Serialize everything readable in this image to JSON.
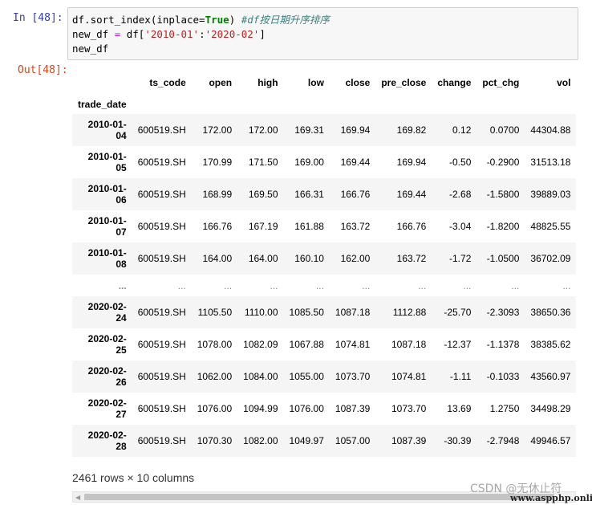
{
  "input_prompt": "In  [48]:",
  "output_prompt": "Out[48]:",
  "code": {
    "line1": {
      "a": "df.sort_index(inplace=",
      "kw": "True",
      "b": ") ",
      "comment": "#df按日期升序排序"
    },
    "line2": {
      "a": "new_df ",
      "op": "=",
      "b": " df[",
      "s1": "'2010-01'",
      "c": ":",
      "s2": "'2020-02'",
      "d": "]"
    },
    "line3": "new_df"
  },
  "table": {
    "columns": [
      "ts_code",
      "open",
      "high",
      "low",
      "close",
      "pre_close",
      "change",
      "pct_chg",
      "vol"
    ],
    "index_name": "trade_date",
    "rows": [
      {
        "index": "2010-01-04",
        "cells": [
          "600519.SH",
          "172.00",
          "172.00",
          "169.31",
          "169.94",
          "169.82",
          "0.12",
          "0.0700",
          "44304.88"
        ]
      },
      {
        "index": "2010-01-05",
        "cells": [
          "600519.SH",
          "170.99",
          "171.50",
          "169.00",
          "169.44",
          "169.94",
          "-0.50",
          "-0.2900",
          "31513.18"
        ]
      },
      {
        "index": "2010-01-06",
        "cells": [
          "600519.SH",
          "168.99",
          "169.50",
          "166.31",
          "166.76",
          "169.44",
          "-2.68",
          "-1.5800",
          "39889.03"
        ]
      },
      {
        "index": "2010-01-07",
        "cells": [
          "600519.SH",
          "166.76",
          "167.19",
          "161.88",
          "163.72",
          "166.76",
          "-3.04",
          "-1.8200",
          "48825.55"
        ]
      },
      {
        "index": "2010-01-08",
        "cells": [
          "600519.SH",
          "164.00",
          "164.00",
          "160.10",
          "162.00",
          "163.72",
          "-1.72",
          "-1.0500",
          "36702.09"
        ]
      },
      {
        "index": "...",
        "cells": [
          "...",
          "...",
          "...",
          "...",
          "...",
          "...",
          "...",
          "...",
          "..."
        ]
      },
      {
        "index": "2020-02-24",
        "cells": [
          "600519.SH",
          "1105.50",
          "1110.00",
          "1085.50",
          "1087.18",
          "1112.88",
          "-25.70",
          "-2.3093",
          "38650.36"
        ]
      },
      {
        "index": "2020-02-25",
        "cells": [
          "600519.SH",
          "1078.00",
          "1082.09",
          "1067.88",
          "1074.81",
          "1087.18",
          "-12.37",
          "-1.1378",
          "38385.62"
        ]
      },
      {
        "index": "2020-02-26",
        "cells": [
          "600519.SH",
          "1062.00",
          "1084.00",
          "1055.00",
          "1073.70",
          "1074.81",
          "-1.11",
          "-0.1033",
          "43560.97"
        ]
      },
      {
        "index": "2020-02-27",
        "cells": [
          "600519.SH",
          "1076.00",
          "1094.99",
          "1076.00",
          "1087.39",
          "1073.70",
          "13.69",
          "1.2750",
          "34498.29"
        ]
      },
      {
        "index": "2020-02-28",
        "cells": [
          "600519.SH",
          "1070.30",
          "1082.00",
          "1049.97",
          "1057.00",
          "1087.39",
          "-30.39",
          "-2.7948",
          "49946.57"
        ]
      }
    ]
  },
  "shape_text": "2461 rows × 10 columns",
  "watermark": "CSDN @无休止符",
  "watermark_site": "www.aspphp.online"
}
